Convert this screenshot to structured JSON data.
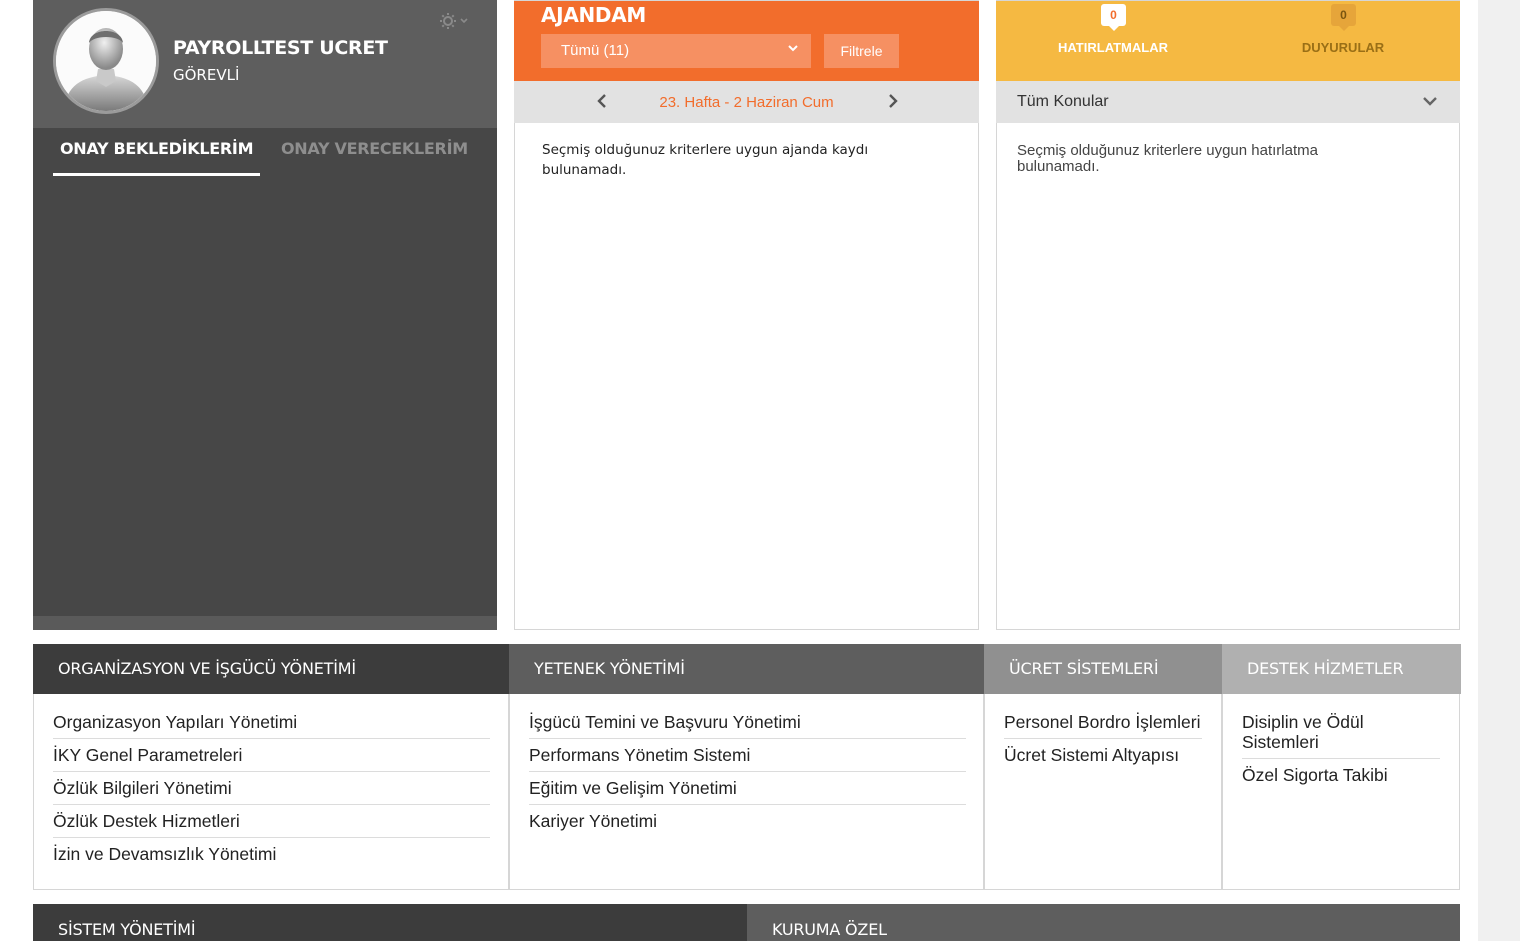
{
  "profile": {
    "name": "PAYROLLTEST UCRET",
    "role": "GÖREVLİ",
    "tabs": [
      "ONAY BEKLEDİKLERİM",
      "ONAY VERECEKLERİM"
    ],
    "active_tab": "ONAY BEKLEDİKLERİM"
  },
  "agenda": {
    "title": "AJANDAM",
    "select_value": "Tümü (11)",
    "filter_label": "Filtrele",
    "week_label": "23. Hafta - 2 Haziran Cum",
    "empty_message": "Seçmiş olduğunuz kriterlere uygun ajanda kaydı bulunamadı."
  },
  "reminders": {
    "tabs": [
      {
        "label": "HATIRLATMALAR",
        "count": "0"
      },
      {
        "label": "DUYURULAR",
        "count": "0"
      }
    ],
    "topic_select": "Tüm Konular",
    "empty_message": "Seçmiş olduğunuz kriterlere uygun hatırlatma bulunamadı."
  },
  "modules": [
    {
      "title": "ORGANİZASYON VE İŞGÜCÜ YÖNETİMİ",
      "items": [
        "Organizasyon Yapıları Yönetimi",
        "İKY Genel Parametreleri",
        "Özlük Bilgileri Yönetimi",
        "Özlük Destek Hizmetleri",
        "İzin ve Devamsızlık Yönetimi"
      ]
    },
    {
      "title": "YETENEK YÖNETİMİ",
      "items": [
        "İşgücü Temini ve Başvuru Yönetimi",
        "Performans Yönetim Sistemi",
        "Eğitim ve Gelişim Yönetimi",
        "Kariyer Yönetimi"
      ]
    },
    {
      "title": "ÜCRET SİSTEMLERİ",
      "items": [
        "Personel Bordro İşlemleri",
        "Ücret Sistemi Altyapısı"
      ]
    },
    {
      "title": "DESTEK HİZMETLER",
      "items": [
        "Disiplin ve Ödül Sistemleri",
        "Özel Sigorta Takibi"
      ]
    }
  ],
  "bottom_sections": [
    "SİSTEM YÖNETİMİ",
    "KURUMA ÖZEL"
  ],
  "icons": {
    "gear": "gear-icon",
    "prev": "chevron-left-icon",
    "next": "chevron-right-icon",
    "dropdown": "chevron-down-icon"
  },
  "colors": {
    "agenda_accent": "#f26d2c",
    "reminder_accent": "#f5b942",
    "dark_panel": "#474747"
  }
}
